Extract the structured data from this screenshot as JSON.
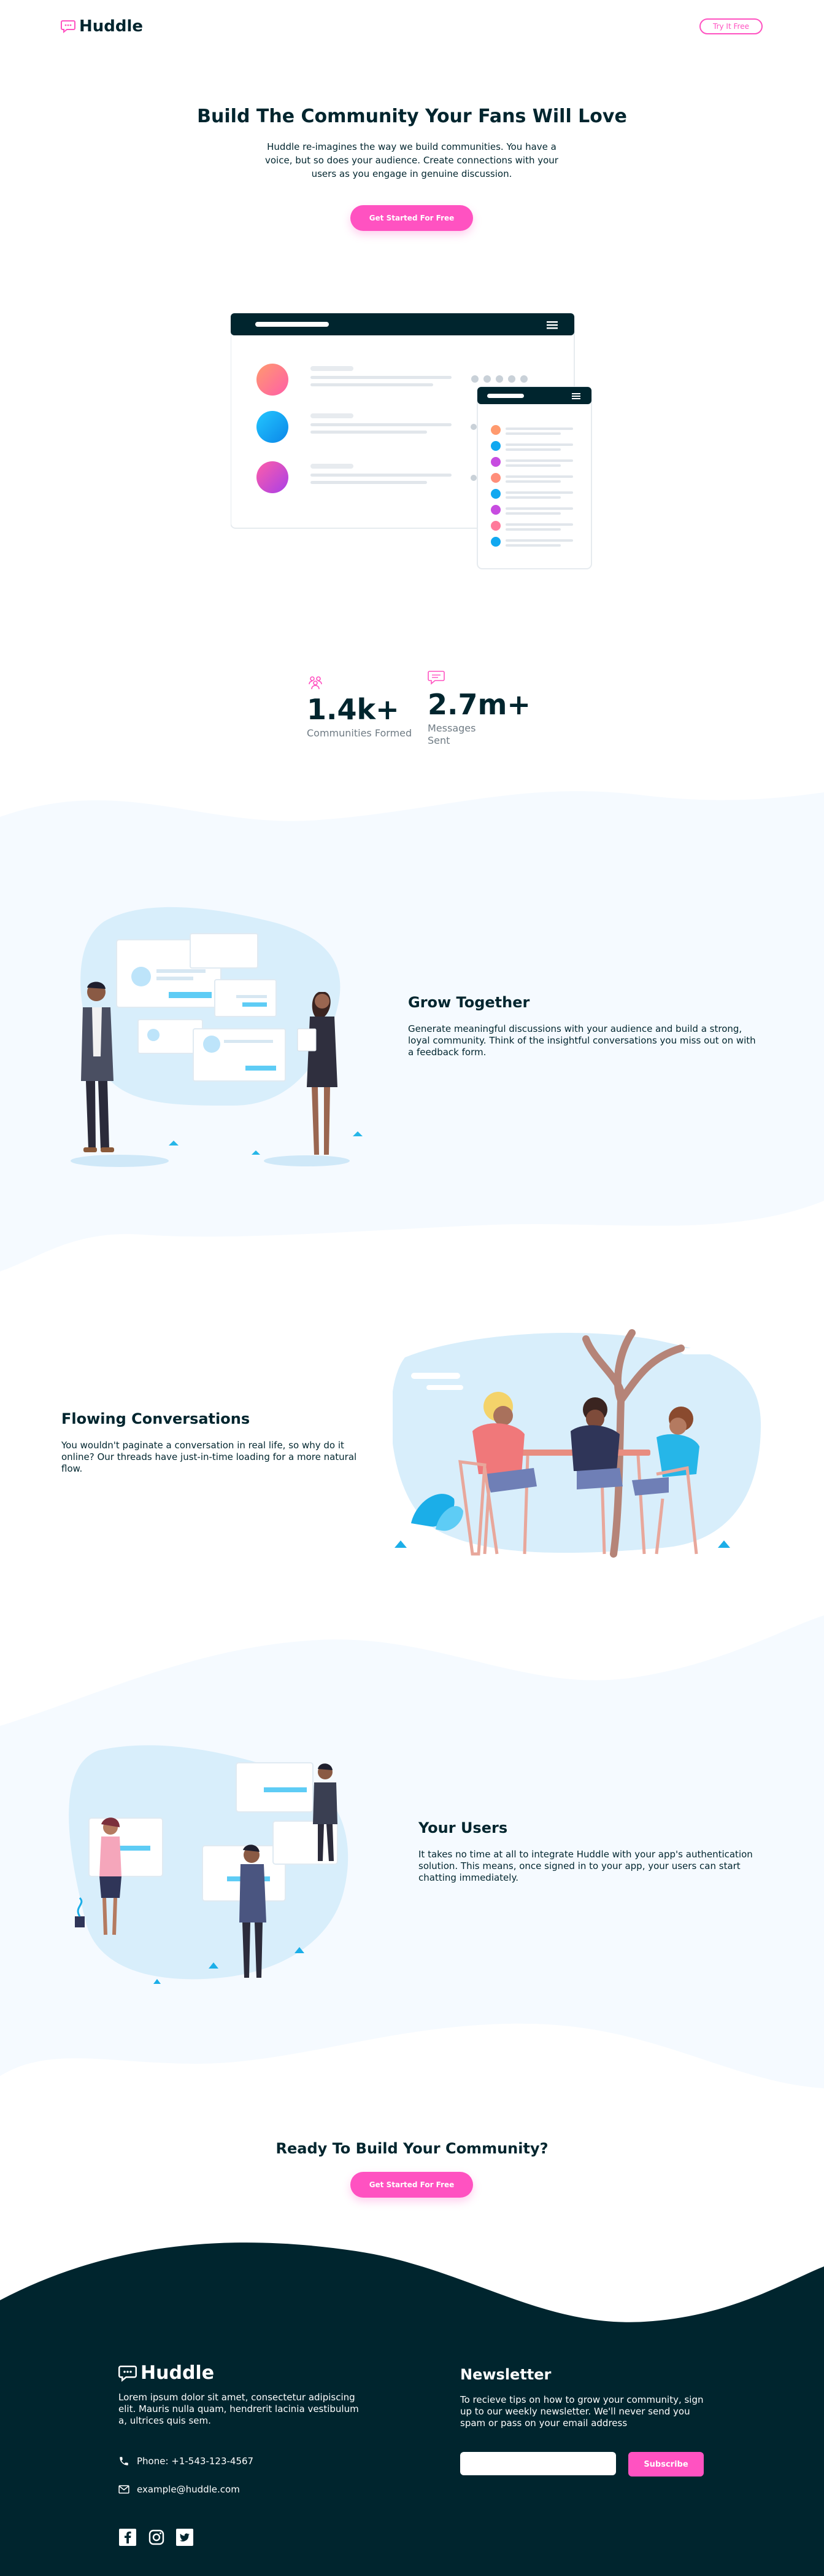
{
  "header": {
    "logo_text": "Huddle",
    "try_button": "Try It Free"
  },
  "hero": {
    "title": "Build The Community Your Fans Will Love",
    "text": "Huddle re-imagines the way we build communities. You have a voice, but so does your audience. Create connections with your users as you engage in genuine discussion.",
    "cta": "Get Started For Free"
  },
  "stats": [
    {
      "value": "1.4k+",
      "label": "Communities Formed",
      "icon": "communities-icon"
    },
    {
      "value": "2.7m+",
      "label_line1": "Messages",
      "label_line2": "Sent",
      "icon": "messages-icon"
    }
  ],
  "features": [
    {
      "title": "Grow Together",
      "text": "Generate meaningful discussions with your audience and build a strong, loyal community. Think of the insightful conversations you miss out on with a feedback form."
    },
    {
      "title": "Flowing Conversations",
      "text": "You wouldn't paginate a conversation in real life, so why do it online? Our threads have just-in-time loading for a more natural flow."
    },
    {
      "title": "Your Users",
      "text": "It takes no time at all to integrate Huddle with your app's authentication solution. This means, once signed in to your app, your users can start chatting immediately."
    }
  ],
  "cta": {
    "title": "Ready To Build Your Community?",
    "button": "Get Started For Free"
  },
  "footer": {
    "logo_text": "Huddle",
    "description": "Lorem ipsum dolor sit amet, consectetur adipiscing elit. Mauris nulla quam, hendrerit lacinia vestibulum a, ultrices quis sem.",
    "phone": "Phone: +1-543-123-4567",
    "email": "example@huddle.com",
    "newsletter_title": "Newsletter",
    "newsletter_text": "To recieve tips on how to grow your community, sign up to our weekly newsletter. We'll never send you spam or pass on your email address",
    "subscribe": "Subscribe",
    "social": [
      "facebook-icon",
      "instagram-icon",
      "twitter-icon"
    ]
  },
  "colors": {
    "navy": "#00252E",
    "pink": "#FF52C1",
    "light_blue_bg": "#F5FAFF",
    "footer_bg": "#00252E"
  }
}
